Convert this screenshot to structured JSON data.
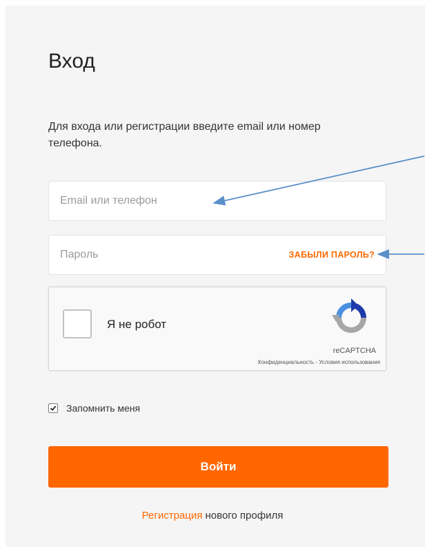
{
  "login": {
    "title": "Вход",
    "subtitle": "Для входа или регистрации введите email или номер телефона.",
    "email_placeholder": "Email или телефон",
    "password_placeholder": "Пароль",
    "forgot_password": "ЗАБЫЛИ ПАРОЛЬ?",
    "remember_me": "Запомнить меня",
    "remember_checked": true,
    "submit": "Войти",
    "register_link": "Регистрация",
    "register_rest": "нового профиля"
  },
  "captcha": {
    "label": "Я не робот",
    "brand": "reCAPTCHA",
    "privacy": "Конфиденциальность",
    "separator": " - ",
    "terms": "Условия использования"
  },
  "colors": {
    "accent": "#ff6600",
    "panel_bg": "#f5f5f5",
    "annotation_arrow": "#5b8fc9"
  },
  "icons": {
    "captcha_logo": "recaptcha-logo-icon",
    "checkmark": "checkmark-icon",
    "arrow": "arrow-annotation-icon"
  }
}
